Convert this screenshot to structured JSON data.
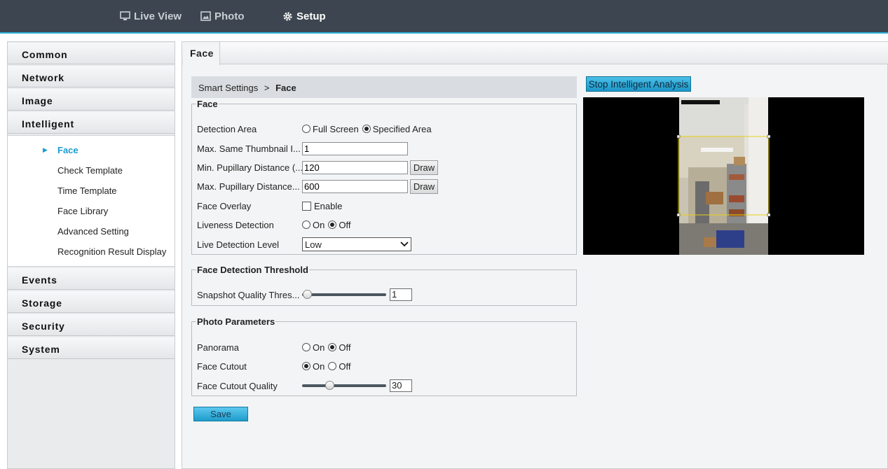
{
  "topnav": {
    "live_view": "Live View",
    "photo": "Photo",
    "setup": "Setup"
  },
  "sidebar": {
    "common": "Common",
    "network": "Network",
    "image": "Image",
    "intelligent": "Intelligent",
    "sub_items": [
      "Face",
      "Check Template",
      "Time Template",
      "Face Library",
      "Advanced Setting",
      "Recognition Result Display"
    ],
    "events": "Events",
    "storage": "Storage",
    "security": "Security",
    "system": "System"
  },
  "tab": {
    "label": "Face"
  },
  "breadcrumb": {
    "parent": "Smart Settings",
    "sep": ">",
    "current": "Face"
  },
  "face_group": {
    "legend": "Face",
    "detection_area_label": "Detection Area",
    "full_screen": "Full Screen",
    "specified_area": "Specified Area",
    "detection_area_value": "Specified Area",
    "max_thumb_label": "Max. Same Thumbnail I...",
    "max_thumb_value": "1",
    "min_pupil_label": "Min. Pupillary Distance (...",
    "min_pupil_value": "120",
    "max_pupil_label": "Max. Pupillary Distance...",
    "max_pupil_value": "600",
    "draw_label": "Draw",
    "face_overlay_label": "Face Overlay",
    "enable_label": "Enable",
    "face_overlay_checked": false,
    "liveness_label": "Liveness Detection",
    "on_label": "On",
    "off_label": "Off",
    "liveness_value": "Off",
    "live_level_label": "Live Detection Level",
    "live_level_value": "Low"
  },
  "threshold_group": {
    "legend": "Face Detection Threshold",
    "snapshot_label": "Snapshot Quality Thres...",
    "snapshot_value": "1",
    "snapshot_fraction": 0.0
  },
  "photo_group": {
    "legend": "Photo Parameters",
    "panorama_label": "Panorama",
    "panorama_value": "Off",
    "cutout_label": "Face Cutout",
    "cutout_value": "On",
    "cutout_quality_label": "Face Cutout Quality",
    "cutout_quality_value": "30",
    "cutout_quality_fraction": 0.3,
    "on_label": "On",
    "off_label": "Off"
  },
  "save_label": "Save",
  "stop_button_label": "Stop Intelligent Analysis",
  "colors": {
    "accent": "#2eb0d8",
    "topbar": "#3d4650",
    "active_text": "#1a9cd0"
  }
}
